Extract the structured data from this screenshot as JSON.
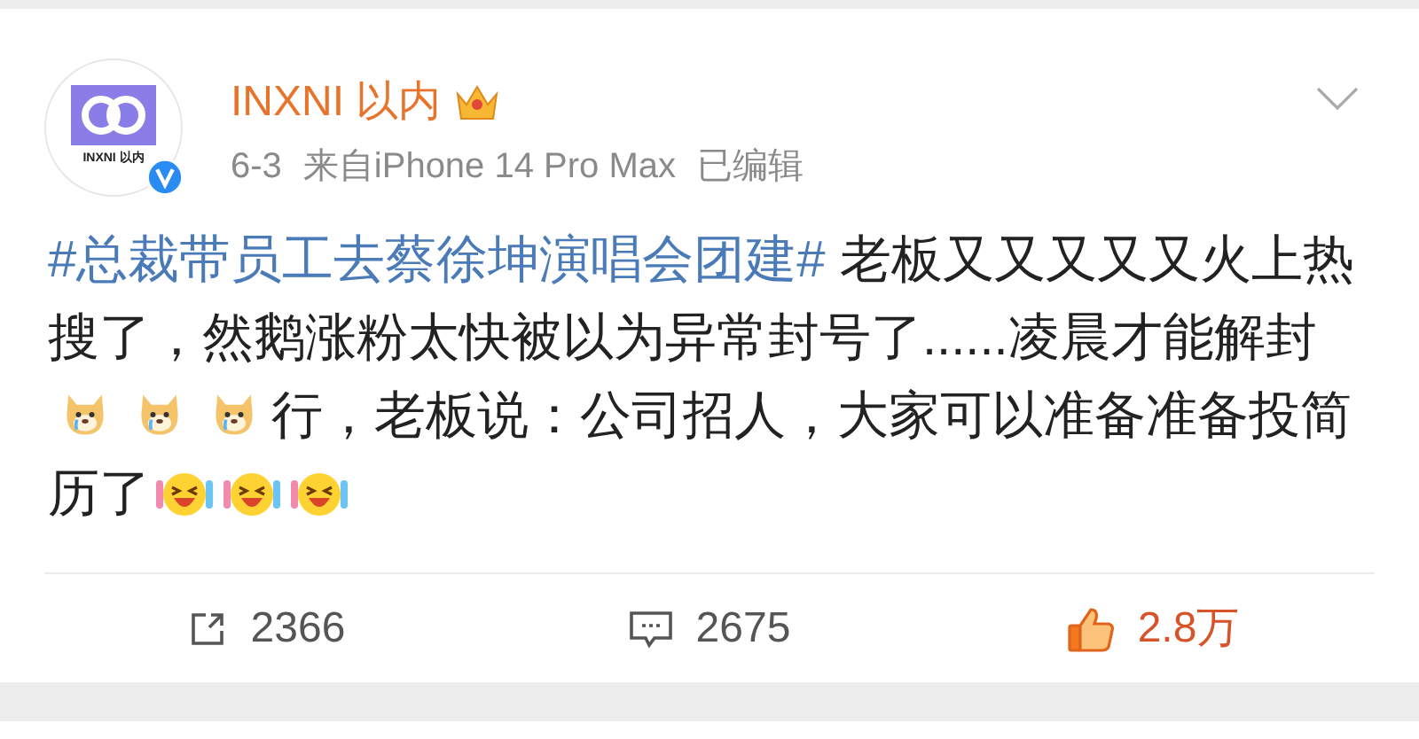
{
  "post": {
    "author": {
      "name": "INXNI 以内",
      "avatar_label": "INXNI 以内",
      "verified": true
    },
    "meta": {
      "date": "6-3",
      "source": "来自iPhone 14 Pro Max",
      "edited": "已编辑"
    },
    "body": [
      {
        "kind": "hashtag",
        "text": "#总裁带员工去蔡徐坤演唱会团建#"
      },
      {
        "kind": "text",
        "text": " 老板又又又又又火上热搜了，然鹅涨粉太快被以为异常封号了......凌晨才能解封"
      },
      {
        "kind": "doge"
      },
      {
        "kind": "doge"
      },
      {
        "kind": "doge"
      },
      {
        "kind": "text",
        "text": "行，老板说：公司招人，大家可以准备准备投简历了"
      },
      {
        "kind": "laugh"
      },
      {
        "kind": "laugh"
      },
      {
        "kind": "laugh"
      }
    ],
    "actions": [
      {
        "kind": "repost",
        "count": "2366"
      },
      {
        "kind": "comment",
        "count": "2675"
      },
      {
        "kind": "like",
        "count": "2.8万",
        "selected": true
      }
    ]
  }
}
